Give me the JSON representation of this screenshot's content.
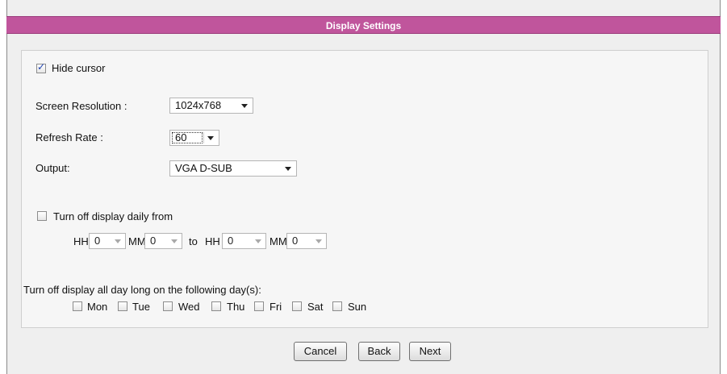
{
  "header": {
    "title": "Display Settings"
  },
  "hide_cursor": {
    "label": "Hide cursor",
    "checked": true
  },
  "screen_resolution": {
    "label": "Screen Resolution :",
    "value": "1024x768"
  },
  "refresh_rate": {
    "label": "Refresh Rate :",
    "value": "60"
  },
  "output": {
    "label": "Output:",
    "value": "VGA D-SUB"
  },
  "turn_off_daily": {
    "label": "Turn off display daily from",
    "checked": false,
    "from_hh_label": "HH",
    "from_hh": "0",
    "from_mm_label": "MM",
    "from_mm": "0",
    "to_label": "to",
    "to_hh_label": "HH",
    "to_hh": "0",
    "to_mm_label": "MM",
    "to_mm": "0"
  },
  "turn_off_days": {
    "label": "Turn off display all day long on the following day(s):",
    "days": [
      "Mon",
      "Tue",
      "Wed",
      "Thu",
      "Fri",
      "Sat",
      "Sun"
    ]
  },
  "buttons": {
    "cancel": "Cancel",
    "back": "Back",
    "next": "Next"
  },
  "colors": {
    "titlebar": "#c0559c",
    "panel": "#f6f6f6"
  },
  "icons": {
    "dropdown": "chevron-down-icon",
    "checkbox": "checkbox-icon"
  }
}
